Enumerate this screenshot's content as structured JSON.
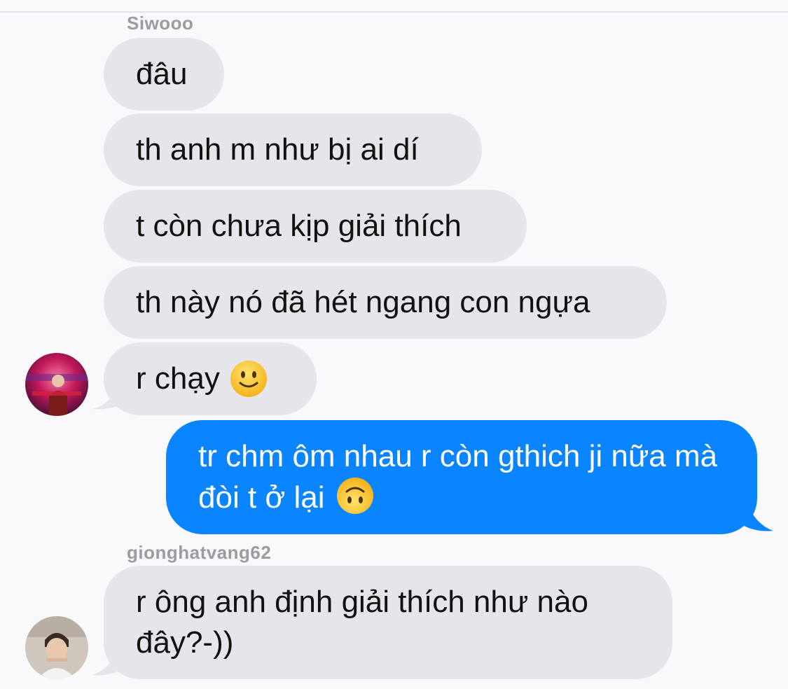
{
  "thread": {
    "groups": [
      {
        "sender": "Siwooo",
        "messages": [
          "đâu",
          "th anh m như bị ai dí",
          "t còn chưa kịp giải thích",
          "th này nó đã hét ngang con ngựa",
          "r chạy"
        ],
        "last_emoji": "slightly-smiling-face-icon"
      },
      {
        "sender": "me",
        "messages": [
          "tr chm ôm nhau r còn gthich ji nữa mà đòi t ở lại"
        ],
        "last_emoji": "upside-down-face-icon"
      },
      {
        "sender": "gionghatvang62",
        "messages": [
          "r ông anh định giải thích như nào đây?-))"
        ]
      }
    ]
  },
  "colors": {
    "background": "#f9f9fb",
    "incoming_bubble": "#e6e5eb",
    "outgoing_bubble": "#0a84ff",
    "sender_name": "#9b9ba1"
  }
}
